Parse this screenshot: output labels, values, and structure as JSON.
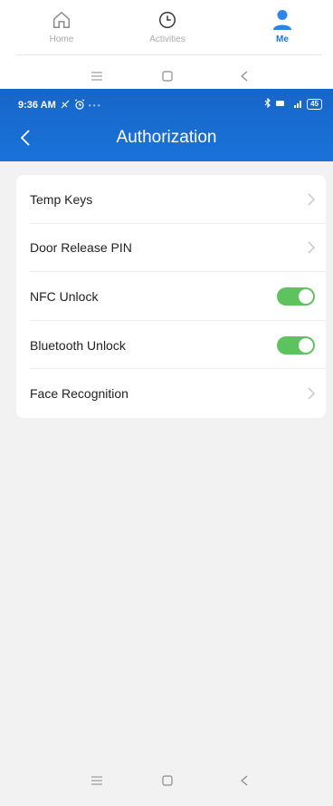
{
  "bottom_tabs": [
    {
      "label": "Home",
      "icon": "home-icon",
      "active": false
    },
    {
      "label": "Activities",
      "icon": "clock-icon",
      "active": false
    },
    {
      "label": "Me",
      "icon": "person-icon",
      "active": true
    }
  ],
  "status_bar": {
    "time": "9:36 AM",
    "battery": "45"
  },
  "header": {
    "title": "Authorization"
  },
  "settings": [
    {
      "label": "Temp Keys",
      "control": "chevron"
    },
    {
      "label": "Door Release PIN",
      "control": "chevron"
    },
    {
      "label": "NFC Unlock",
      "control": "toggle",
      "on": true
    },
    {
      "label": "Bluetooth Unlock",
      "control": "toggle",
      "on": true
    },
    {
      "label": "Face Recognition",
      "control": "chevron"
    }
  ],
  "colors": {
    "header_blue": "#1a72d8",
    "toggle_green": "#5cc35f",
    "active_tab": "#1a78d6"
  }
}
